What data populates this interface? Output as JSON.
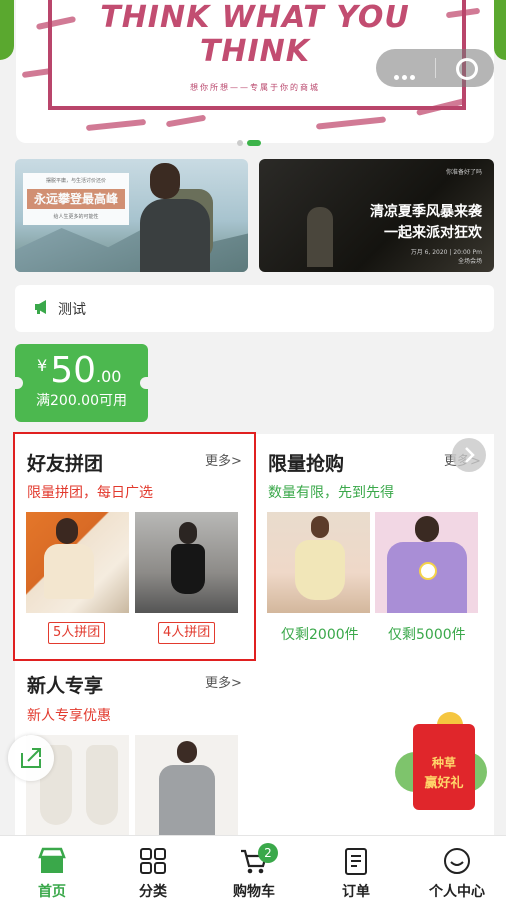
{
  "banner": {
    "headline_line1": "THINK WHAT YOU",
    "headline_line2": "THINK",
    "tagline": "想你所想——专属于你的商城",
    "slide_count": 3,
    "active_slide": 2
  },
  "promo_left": {
    "small_top": "摆脱平庸，与生活讨价还价",
    "headline": "永远攀登最高峰",
    "small_bottom": "给人生更多的可能性"
  },
  "promo_right": {
    "small_top": "你准备好了吗",
    "line1": "清凉夏季风暴来袭",
    "line2": "一起来派对狂欢",
    "small_bottom": "万月 6, 2020 | 20:00 Pm",
    "small_place": "全场会场"
  },
  "notice": {
    "text": "测试",
    "icon": "megaphone-icon"
  },
  "coupon": {
    "currency": "¥",
    "amount_int": "50",
    "amount_dec": ".00",
    "condition": "满200.00可用"
  },
  "group_buy": {
    "title": "好友拼团",
    "more": "更多>",
    "subtitle": "限量拼团，每日广选",
    "items": [
      {
        "tag": "5人拼团"
      },
      {
        "tag": "4人拼团"
      }
    ]
  },
  "flash_sale": {
    "title": "限量抢购",
    "more": "更多>",
    "subtitle": "数量有限，先到先得",
    "items": [
      {
        "stock": "仅剩2000件"
      },
      {
        "stock": "仅剩5000件"
      }
    ]
  },
  "new_user": {
    "title": "新人专享",
    "more": "更多>",
    "subtitle": "新人专享优惠"
  },
  "float_gift": {
    "line1": "种草",
    "line2": "赢好礼"
  },
  "tabbar": {
    "items": [
      {
        "label": "首页",
        "icon": "shop-icon"
      },
      {
        "label": "分类",
        "icon": "grid-icon"
      },
      {
        "label": "购物车",
        "icon": "cart-icon"
      },
      {
        "label": "订单",
        "icon": "order-icon"
      },
      {
        "label": "个人中心",
        "icon": "smile-icon"
      }
    ],
    "cart_badge": "2",
    "active_index": 0
  },
  "colors": {
    "accent_green": "#3aa84a",
    "accent_red": "#e23a2e",
    "banner_pink": "#c24d71"
  }
}
